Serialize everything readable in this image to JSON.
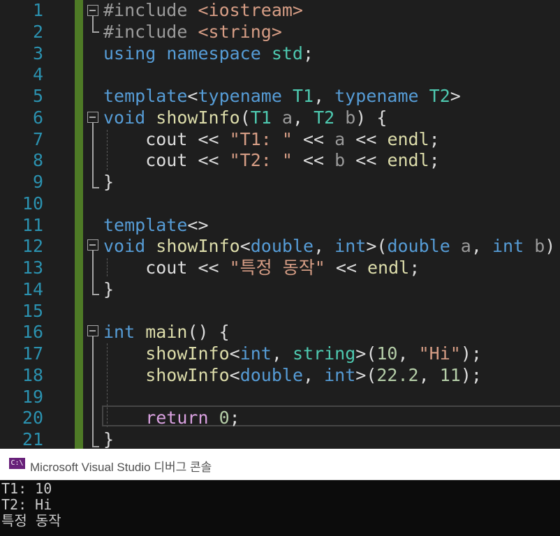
{
  "editor": {
    "line_numbers": [
      "1",
      "2",
      "3",
      "4",
      "5",
      "6",
      "7",
      "8",
      "9",
      "10",
      "11",
      "12",
      "13",
      "14",
      "15",
      "16",
      "17",
      "18",
      "19",
      "20",
      "21"
    ],
    "lines": [
      [
        {
          "t": "#include ",
          "c": "pp"
        },
        {
          "t": "<iostream>",
          "c": "str"
        }
      ],
      [
        {
          "t": "#include ",
          "c": "pp"
        },
        {
          "t": "<string>",
          "c": "str"
        }
      ],
      [
        {
          "t": "using ",
          "c": "kw"
        },
        {
          "t": "namespace ",
          "c": "kw"
        },
        {
          "t": "std",
          "c": "ty"
        },
        {
          "t": ";",
          "c": "pl"
        }
      ],
      [],
      [
        {
          "t": "template",
          "c": "kw"
        },
        {
          "t": "<",
          "c": "pl"
        },
        {
          "t": "typename ",
          "c": "kw"
        },
        {
          "t": "T1",
          "c": "ty"
        },
        {
          "t": ", ",
          "c": "pl"
        },
        {
          "t": "typename ",
          "c": "kw"
        },
        {
          "t": "T2",
          "c": "ty"
        },
        {
          "t": ">",
          "c": "pl"
        }
      ],
      [
        {
          "t": "void ",
          "c": "kw"
        },
        {
          "t": "showInfo",
          "c": "fn"
        },
        {
          "t": "(",
          "c": "pl"
        },
        {
          "t": "T1 ",
          "c": "ty"
        },
        {
          "t": "a",
          "c": "par"
        },
        {
          "t": ", ",
          "c": "pl"
        },
        {
          "t": "T2 ",
          "c": "ty"
        },
        {
          "t": "b",
          "c": "par"
        },
        {
          "t": ") {",
          "c": "pl"
        }
      ],
      [
        {
          "t": "    cout ",
          "c": "pl"
        },
        {
          "t": "<< ",
          "c": "pl"
        },
        {
          "t": "\"T1: \"",
          "c": "str"
        },
        {
          "t": " << ",
          "c": "pl"
        },
        {
          "t": "a",
          "c": "par"
        },
        {
          "t": " << ",
          "c": "pl"
        },
        {
          "t": "endl",
          "c": "fn"
        },
        {
          "t": ";",
          "c": "pl"
        }
      ],
      [
        {
          "t": "    cout ",
          "c": "pl"
        },
        {
          "t": "<< ",
          "c": "pl"
        },
        {
          "t": "\"T2: \"",
          "c": "str"
        },
        {
          "t": " << ",
          "c": "pl"
        },
        {
          "t": "b",
          "c": "par"
        },
        {
          "t": " << ",
          "c": "pl"
        },
        {
          "t": "endl",
          "c": "fn"
        },
        {
          "t": ";",
          "c": "pl"
        }
      ],
      [
        {
          "t": "}",
          "c": "pl"
        }
      ],
      [],
      [
        {
          "t": "template",
          "c": "kw"
        },
        {
          "t": "<>",
          "c": "pl"
        }
      ],
      [
        {
          "t": "void ",
          "c": "kw"
        },
        {
          "t": "showInfo",
          "c": "fn"
        },
        {
          "t": "<",
          "c": "pl"
        },
        {
          "t": "double",
          "c": "kw"
        },
        {
          "t": ", ",
          "c": "pl"
        },
        {
          "t": "int",
          "c": "kw"
        },
        {
          "t": ">(",
          "c": "pl"
        },
        {
          "t": "double ",
          "c": "kw"
        },
        {
          "t": "a",
          "c": "par"
        },
        {
          "t": ", ",
          "c": "pl"
        },
        {
          "t": "int ",
          "c": "kw"
        },
        {
          "t": "b",
          "c": "par"
        },
        {
          "t": ") {",
          "c": "pl"
        }
      ],
      [
        {
          "t": "    cout ",
          "c": "pl"
        },
        {
          "t": "<< ",
          "c": "pl"
        },
        {
          "t": "\"특정 동작\"",
          "c": "str"
        },
        {
          "t": " << ",
          "c": "pl"
        },
        {
          "t": "endl",
          "c": "fn"
        },
        {
          "t": ";",
          "c": "pl"
        }
      ],
      [
        {
          "t": "}",
          "c": "pl"
        }
      ],
      [],
      [
        {
          "t": "int ",
          "c": "kw"
        },
        {
          "t": "main",
          "c": "fn"
        },
        {
          "t": "() {",
          "c": "pl"
        }
      ],
      [
        {
          "t": "    showInfo",
          "c": "fn"
        },
        {
          "t": "<",
          "c": "pl"
        },
        {
          "t": "int",
          "c": "kw"
        },
        {
          "t": ", ",
          "c": "pl"
        },
        {
          "t": "string",
          "c": "ty"
        },
        {
          "t": ">(",
          "c": "pl"
        },
        {
          "t": "10",
          "c": "num"
        },
        {
          "t": ", ",
          "c": "pl"
        },
        {
          "t": "\"Hi\"",
          "c": "str"
        },
        {
          "t": ");",
          "c": "pl"
        }
      ],
      [
        {
          "t": "    showInfo",
          "c": "fn"
        },
        {
          "t": "<",
          "c": "pl"
        },
        {
          "t": "double",
          "c": "kw"
        },
        {
          "t": ", ",
          "c": "pl"
        },
        {
          "t": "int",
          "c": "kw"
        },
        {
          "t": ">(",
          "c": "pl"
        },
        {
          "t": "22.2",
          "c": "num"
        },
        {
          "t": ", ",
          "c": "pl"
        },
        {
          "t": "11",
          "c": "num"
        },
        {
          "t": ");",
          "c": "pl"
        }
      ],
      [],
      [
        {
          "t": "    return ",
          "c": "ctl"
        },
        {
          "t": "0",
          "c": "num"
        },
        {
          "t": ";",
          "c": "pl"
        }
      ],
      [
        {
          "t": "}",
          "c": "pl"
        }
      ]
    ]
  },
  "console": {
    "icon_text": "C:\\",
    "title": "Microsoft Visual Studio 디버그 콘솔",
    "output": [
      "T1: 10",
      "T2: Hi",
      "특정 동작"
    ]
  },
  "colors": {
    "background": "#1e1e1e",
    "keyword": "#569cd6",
    "string": "#d69d85",
    "type": "#4ec9b0",
    "function": "#dcdcaa",
    "number": "#b5cea8",
    "control": "#d8a0df",
    "line_number": "#2b91af",
    "change_bar": "#4e7a26"
  }
}
